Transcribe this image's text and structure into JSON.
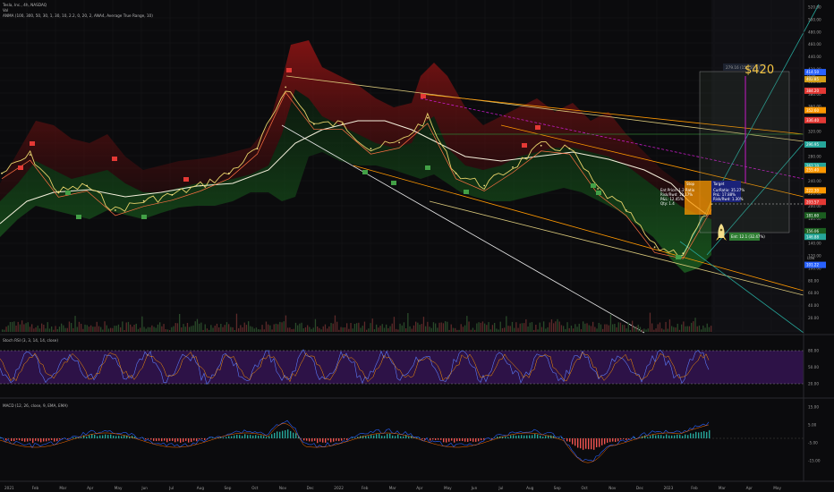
{
  "header": {
    "line1": "Tesla, Inc., 4h, NASDAQ",
    "line2": "Vol",
    "line3": "ANMA (100, 300, 50, 30, 1, 30, 10, 2.2, 0, 20, 2, ANA4, Average True Range, 10)"
  },
  "panes": {
    "stoch_label": "Stoch RSI (3, 3, 14, 14, close)",
    "macd_label": "MACD (12, 26, close, 9, EMA, EMA)"
  },
  "annotations": {
    "target_price": "$420",
    "target_box_label": "279.16 (156.31%)",
    "stop_label": "Stop",
    "target_label": "Target",
    "trade_stats": "Ent Price: 1.2 Ratio",
    "trade_stats_2": "Risk/Rwd: 10.17%",
    "trade_stats_3": "P&L: 12.45%",
    "trade_stats_4": "Qty: 1.4",
    "position_summary": "Ent: 12.1 (32.47%)",
    "long_box_1": "CurRatio: 35.27%",
    "long_box_2": "PnL: 17.88%",
    "long_box_3": "Risk/Rwd: 1.30%",
    "high_label": "High",
    "low_label": "Low"
  },
  "price_axis": [
    "520.00",
    "500.00",
    "480.00",
    "460.00",
    "440.00",
    "420.00",
    "400.00",
    "380.00",
    "360.00",
    "340.00",
    "320.00",
    "300.00",
    "280.00",
    "260.00",
    "240.00",
    "220.00",
    "200.00",
    "180.00",
    "160.00",
    "140.00",
    "120.00",
    "100.00",
    "80.00",
    "60.00",
    "40.00",
    "20.00"
  ],
  "price_tags": [
    {
      "text": "414.50",
      "color": "#2962ff"
    },
    {
      "text": "402.85",
      "color": "#d4a017"
    },
    {
      "text": "384.20",
      "color": "#e53935"
    },
    {
      "text": "352.60",
      "color": "#ff9800"
    },
    {
      "text": "336.40",
      "color": "#e53935"
    },
    {
      "text": "296.95",
      "color": "#26a69a"
    },
    {
      "text": "262.10",
      "color": "#26a69a"
    },
    {
      "text": "255.40",
      "color": "#ff9800"
    },
    {
      "text": "222.30",
      "color": "#ff9800"
    },
    {
      "text": "203.57",
      "color": "#e53935"
    },
    {
      "text": "181.60",
      "color": "#1b5e20"
    },
    {
      "text": "156.06",
      "color": "#1b5e20"
    },
    {
      "text": "146.88",
      "color": "#26a69a"
    },
    {
      "text": "101.22",
      "color": "#2962ff"
    }
  ],
  "stoch_axis": [
    "80.00",
    "50.00",
    "20.00"
  ],
  "macd_axis": [
    "15.00",
    "5.00",
    "-5.00",
    "-15.00"
  ],
  "time_axis": [
    "2021",
    "Feb",
    "Mar",
    "Apr",
    "May",
    "Jun",
    "Jul",
    "Aug",
    "Sep",
    "Oct",
    "Nov",
    "Dec",
    "2022",
    "Feb",
    "Mar",
    "Apr",
    "May",
    "Jun",
    "Jul",
    "Aug",
    "Sep",
    "Oct",
    "Nov",
    "Dec",
    "2023",
    "Feb",
    "Mar",
    "Apr",
    "May"
  ],
  "colors": {
    "background": "#0b0b0d",
    "cloud_red": "#b71c1c",
    "cloud_green": "#1b5e20",
    "ma_white": "#f5f0dc",
    "trend_orange": "#ff9800",
    "trend_yellow": "#d8c77a",
    "trend_magenta": "#c51bc5",
    "trend_teal": "#26a69a",
    "stoch_band": "#4a1a78",
    "target": "#f5c542"
  },
  "chart_data": {
    "type": "line",
    "title": "Tesla, Inc., 4h, NASDAQ",
    "xlabel": "",
    "ylabel": "",
    "ylim": [
      20,
      520
    ],
    "grid": true,
    "series": [
      {
        "name": "Tesla, Inc.",
        "x": [
          "2021-01",
          "2021-02",
          "2021-03",
          "2021-04",
          "2021-05",
          "2021-06",
          "2021-07",
          "2021-08",
          "2021-09",
          "2021-10",
          "2021-11",
          "2021-12",
          "2022-01",
          "2022-02",
          "2022-03",
          "2022-04",
          "2022-05",
          "2022-06",
          "2022-07",
          "2022-08",
          "2022-09",
          "2022-10",
          "2022-11",
          "2022-12",
          "2023-01",
          "2023-02"
        ],
        "values": [
          250,
          280,
          220,
          230,
          190,
          205,
          215,
          230,
          250,
          290,
          390,
          330,
          330,
          290,
          300,
          340,
          250,
          230,
          260,
          295,
          290,
          225,
          190,
          130,
          120,
          200
        ]
      }
    ],
    "target": 420,
    "high_marker": 414.5,
    "low_marker": 101.22
  }
}
